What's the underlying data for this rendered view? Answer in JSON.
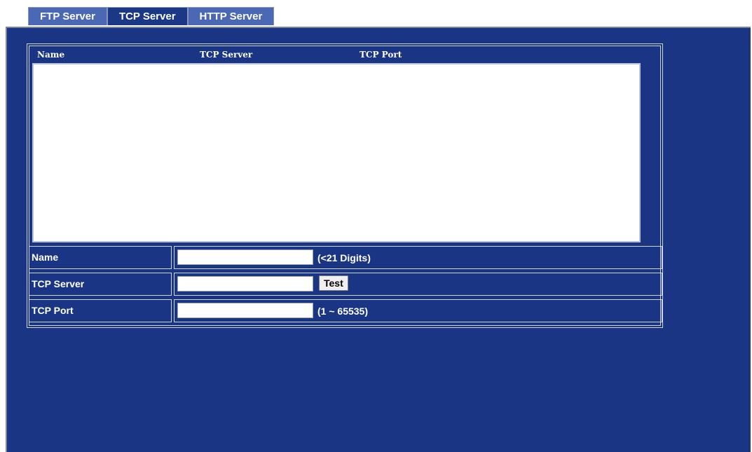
{
  "tabs": [
    {
      "label": "FTP Server",
      "active": false
    },
    {
      "label": "TCP Server",
      "active": true
    },
    {
      "label": "HTTP Server",
      "active": false
    }
  ],
  "server_list": {
    "columns": [
      "Name",
      "TCP Server",
      "TCP Port"
    ],
    "rows": []
  },
  "form": {
    "name": {
      "label": "Name",
      "value": "",
      "hint": "(<21 Digits)"
    },
    "tcp_server": {
      "label": "TCP Server",
      "value": "",
      "button": "Test"
    },
    "tcp_port": {
      "label": "TCP Port",
      "value": "",
      "hint": "(1 ~ 65535)"
    }
  },
  "colors": {
    "panel_background": "#1b3585",
    "active_tab": "#1b3887",
    "inactive_tab": "#4a68b3"
  }
}
